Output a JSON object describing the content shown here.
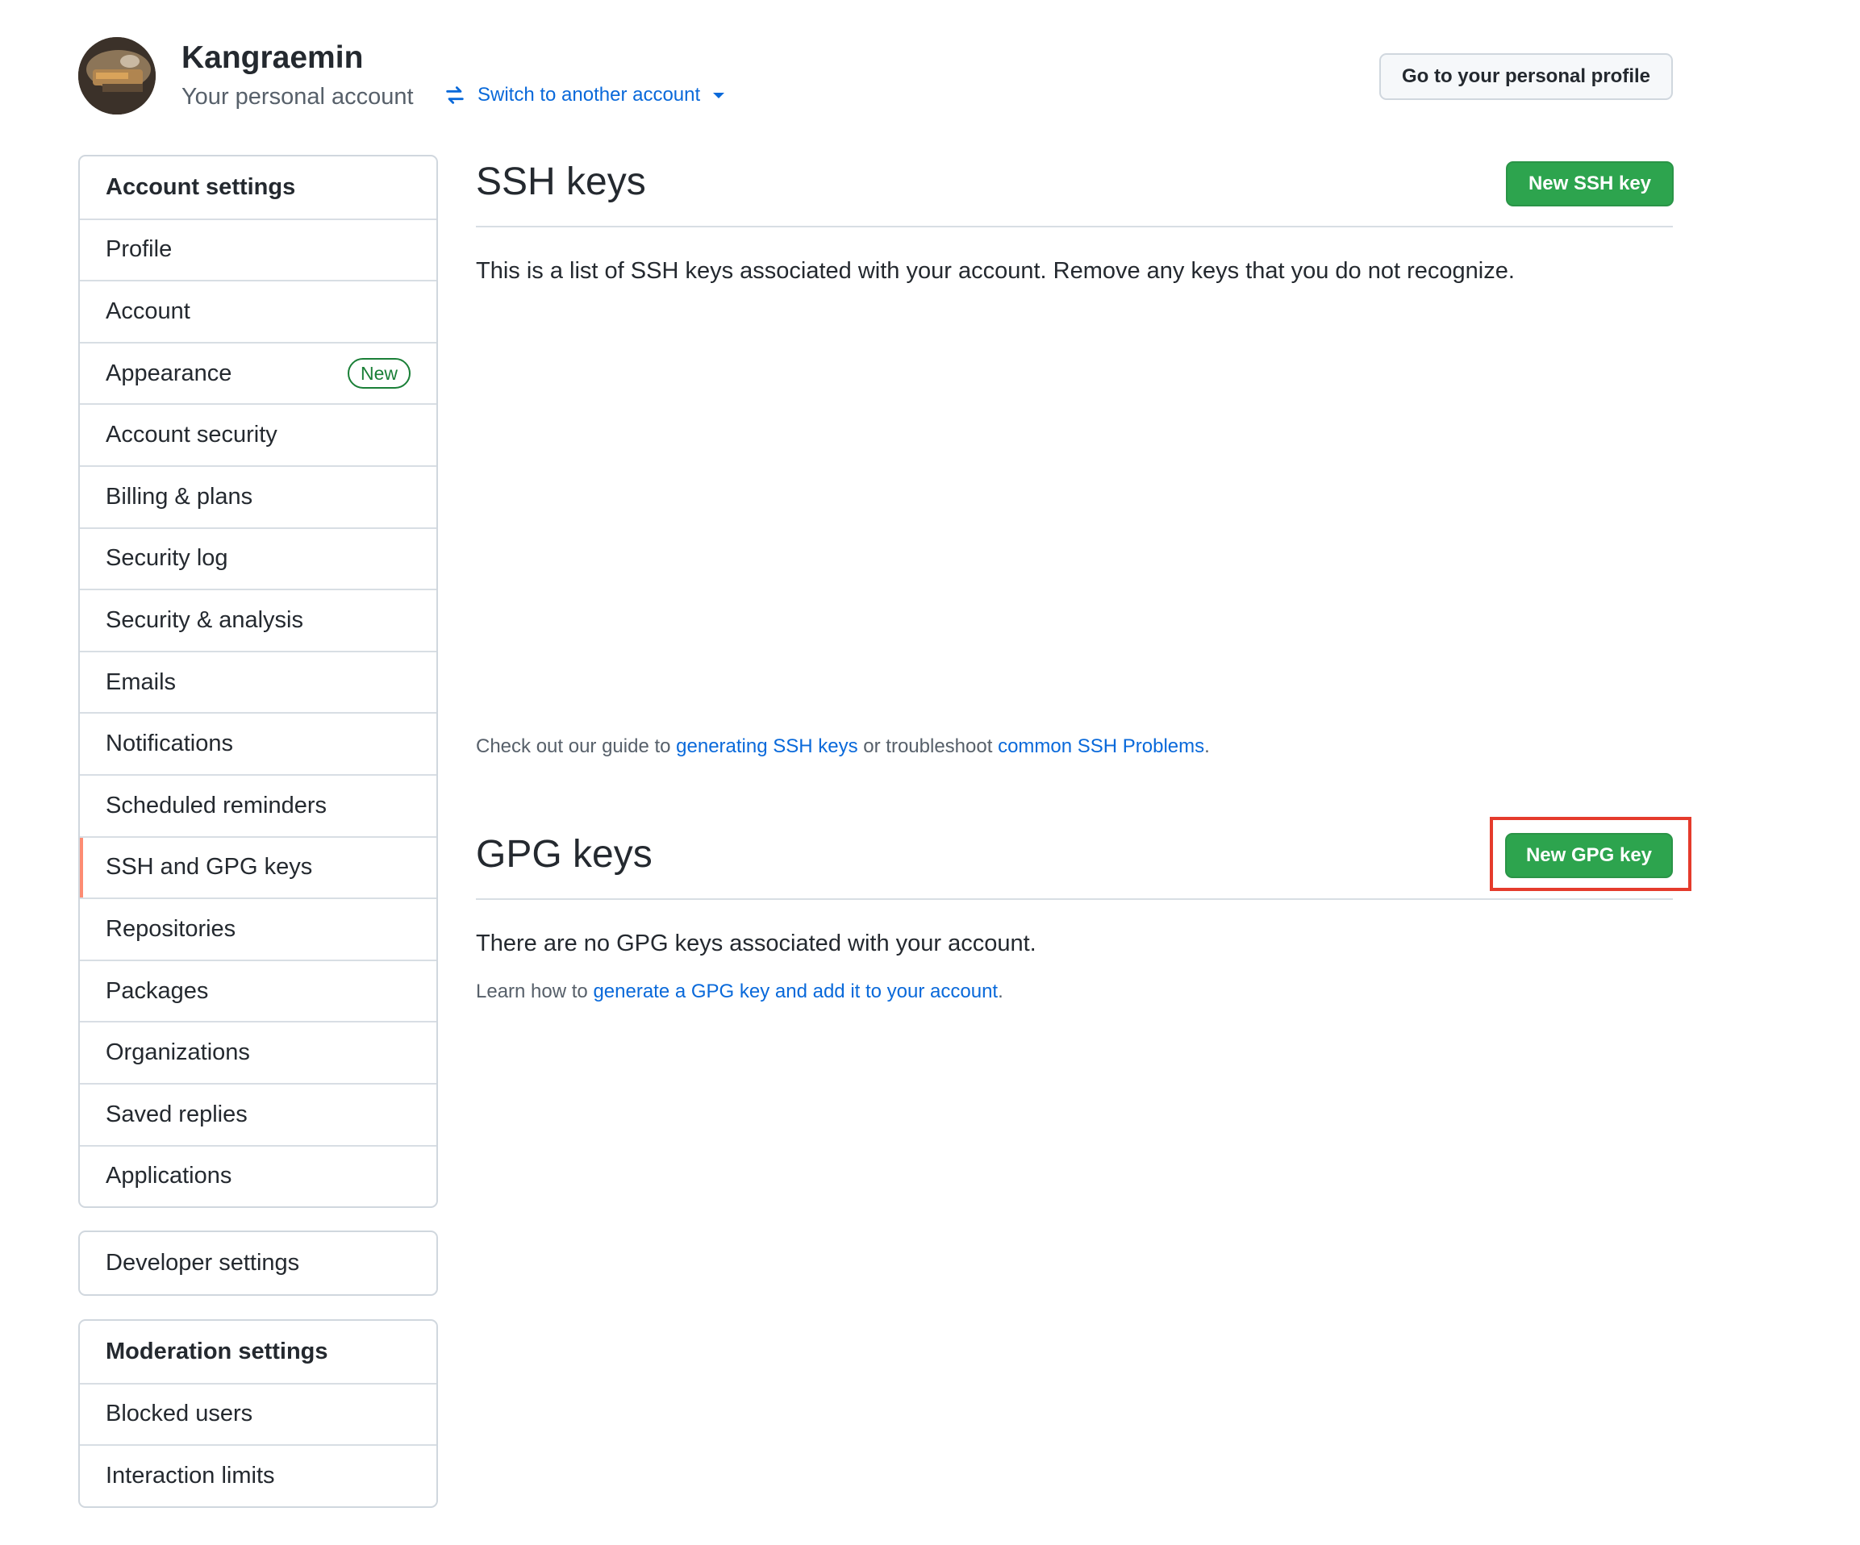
{
  "header": {
    "username": "Kangraemin",
    "subtitle": "Your personal account",
    "switch_label": "Switch to another account",
    "profile_button": "Go to your personal profile"
  },
  "sidebar": {
    "account_settings": {
      "heading": "Account settings",
      "items": [
        {
          "label": "Profile"
        },
        {
          "label": "Account"
        },
        {
          "label": "Appearance",
          "badge": "New"
        },
        {
          "label": "Account security"
        },
        {
          "label": "Billing & plans"
        },
        {
          "label": "Security log"
        },
        {
          "label": "Security & analysis"
        },
        {
          "label": "Emails"
        },
        {
          "label": "Notifications"
        },
        {
          "label": "Scheduled reminders"
        },
        {
          "label": "SSH and GPG keys",
          "selected": true
        },
        {
          "label": "Repositories"
        },
        {
          "label": "Packages"
        },
        {
          "label": "Organizations"
        },
        {
          "label": "Saved replies"
        },
        {
          "label": "Applications"
        }
      ]
    },
    "developer_settings": "Developer settings",
    "moderation_settings": {
      "heading": "Moderation settings",
      "items": [
        {
          "label": "Blocked users"
        },
        {
          "label": "Interaction limits"
        }
      ]
    }
  },
  "ssh": {
    "title": "SSH keys",
    "new_button": "New SSH key",
    "description": "This is a list of SSH keys associated with your account. Remove any keys that you do not recognize.",
    "guide_prefix": "Check out our guide to ",
    "guide_link": "generating SSH keys",
    "guide_middle": " or troubleshoot ",
    "guide_link2": "common SSH Problems",
    "guide_suffix": "."
  },
  "gpg": {
    "title": "GPG keys",
    "new_button": "New GPG key",
    "empty_text": "There are no GPG keys associated with your account.",
    "learn_prefix": "Learn how to ",
    "learn_link": "generate a GPG key and add it to your account",
    "learn_suffix": "."
  },
  "colors": {
    "accent_link": "#0969da",
    "primary_button": "#2da44e",
    "selected_indicator": "#fd8c73",
    "highlight_box": "#e53b2c"
  }
}
